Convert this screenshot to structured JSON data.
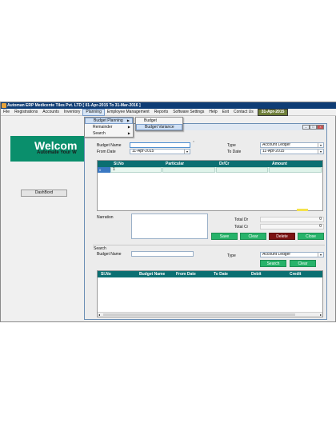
{
  "window": {
    "title": "Automan ERP Medicente Tiles Pvt. LTD [ 01-Apr-2015 To 31-Mar-2016 ]"
  },
  "menubar": {
    "items": [
      "File",
      "Registrations",
      "Accounts",
      "Inventory",
      "Planning",
      "Employee Management",
      "Reports",
      "Software Settings",
      "Help",
      "Exit",
      "Contact Us"
    ],
    "date": "31-Apr-2015"
  },
  "planning_menu": {
    "items": [
      {
        "label": "Budget Planning"
      },
      {
        "label": "Remainder"
      },
      {
        "label": "Search"
      }
    ]
  },
  "budget_submenu": {
    "items": [
      "Budget",
      "Budget Variance"
    ]
  },
  "welcome": {
    "heading": "Welcom",
    "tagline": "Automate Your W"
  },
  "dashboard": {
    "button": "DashBord"
  },
  "form": {
    "budget_name_label": "Budget Name",
    "budget_name_value": "",
    "from_date_label": "From Date",
    "from_date_value": "11-Apr-2015",
    "type_label": "Type",
    "type_value": "Account Ledger",
    "to_date_label": "To Date",
    "to_date_value": "11-Apr-2015",
    "required_marker": "*"
  },
  "entry_grid": {
    "columns": [
      "Sl.No",
      "Particular",
      "Dr/Cr",
      "Amount"
    ],
    "row": {
      "indicator": "0",
      "sl_no": "1"
    }
  },
  "narration": {
    "label": "Narration",
    "value": ""
  },
  "totals": {
    "dr_label": "Total Dr",
    "dr_value": "0",
    "cr_label": "Total Cr",
    "cr_value": "0"
  },
  "actions": {
    "save": "Save",
    "clear": "Clear",
    "delete": "Delete",
    "close": "Close"
  },
  "search": {
    "section_label": "Search",
    "budget_name_label": "Budget Name",
    "budget_name_value": "",
    "type_label": "Type",
    "type_value": "Account Ledger",
    "search_button": "Search",
    "clear_button": "Clear"
  },
  "results_grid": {
    "columns": [
      "Sl.No",
      "Budget Name",
      "From Date",
      "To Date",
      "Debit",
      "Credit"
    ]
  }
}
